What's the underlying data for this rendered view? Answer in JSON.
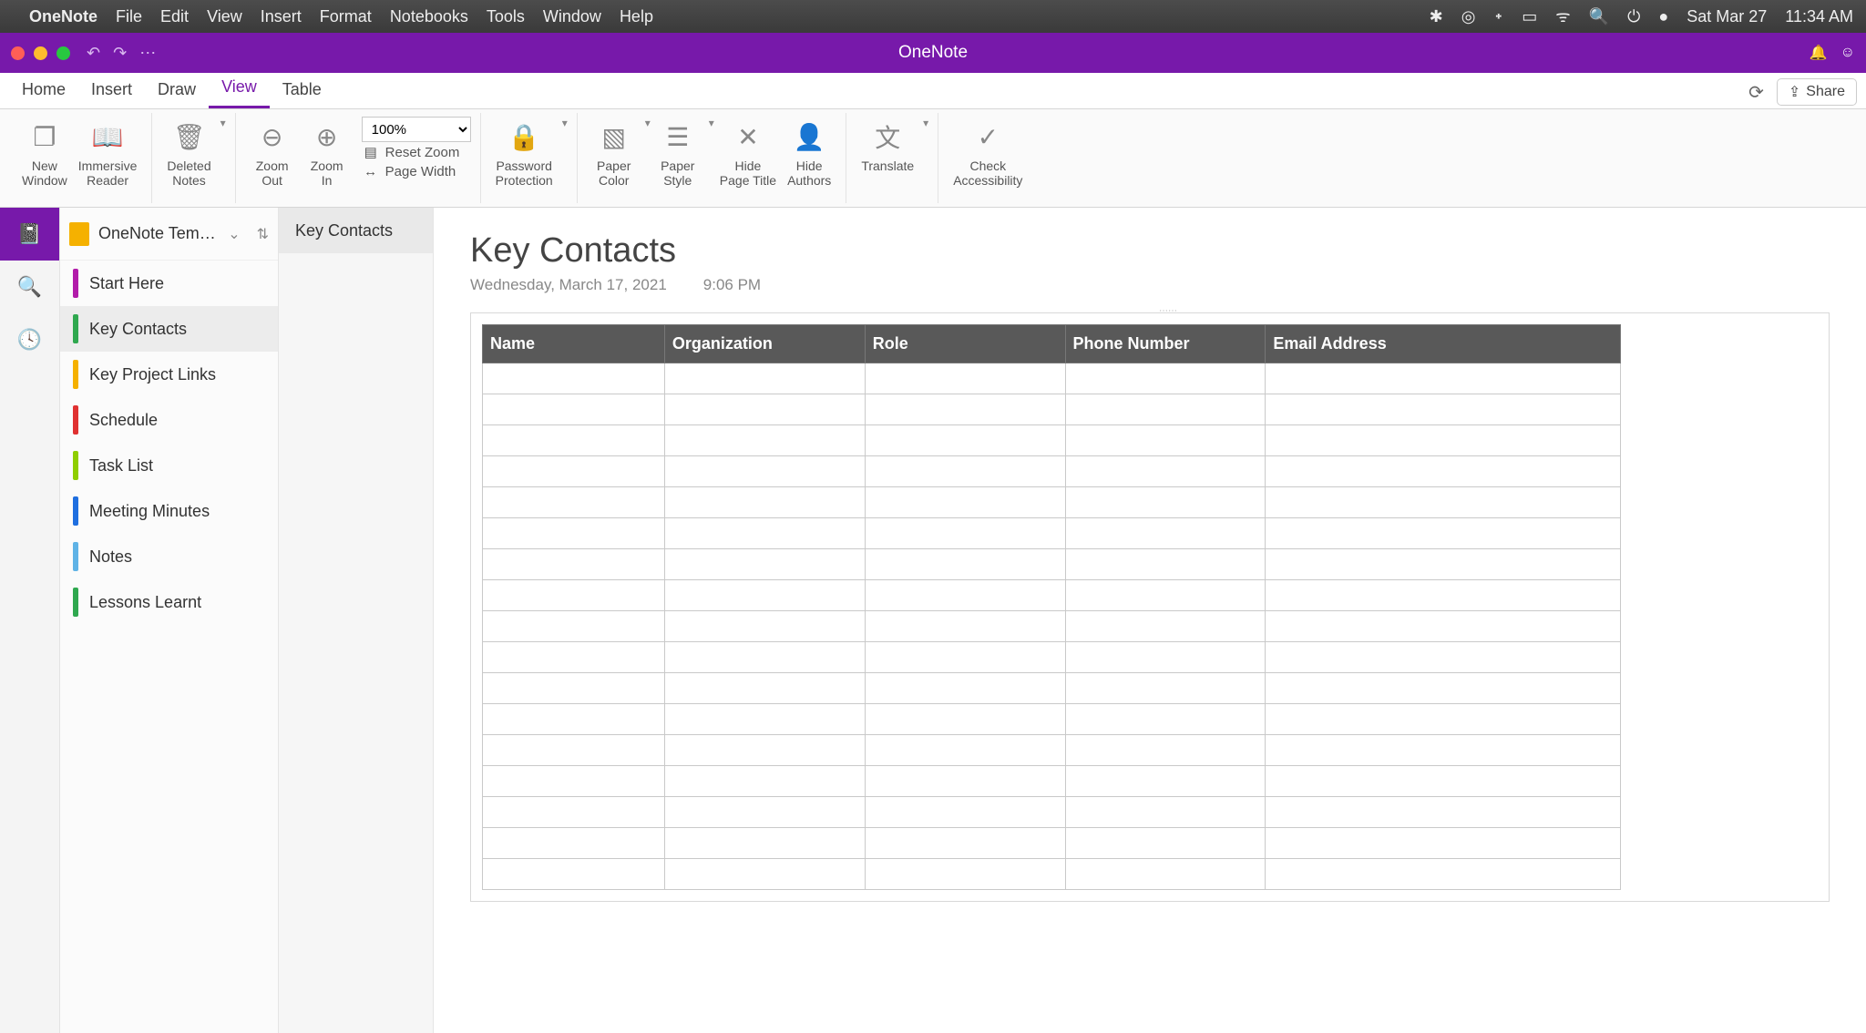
{
  "menubar": {
    "app": "OneNote",
    "items": [
      "File",
      "Edit",
      "View",
      "Insert",
      "Format",
      "Notebooks",
      "Tools",
      "Window",
      "Help"
    ],
    "clock_day": "Sat Mar 27",
    "clock_time": "11:34 AM"
  },
  "titlebar": {
    "title": "OneNote"
  },
  "tabs": {
    "items": [
      "Home",
      "Insert",
      "Draw",
      "View",
      "Table"
    ],
    "active": "View",
    "share": "Share"
  },
  "ribbon": {
    "new_window": "New\nWindow",
    "immersive_reader": "Immersive\nReader",
    "deleted_notes": "Deleted\nNotes",
    "zoom_out": "Zoom\nOut",
    "zoom_in": "Zoom\nIn",
    "zoom_value": "100%",
    "reset_zoom": "Reset Zoom",
    "page_width": "Page Width",
    "password_protection": "Password\nProtection",
    "paper_color": "Paper\nColor",
    "paper_style": "Paper\nStyle",
    "hide_page_title": "Hide\nPage Title",
    "hide_authors": "Hide\nAuthors",
    "translate": "Translate",
    "check_accessibility": "Check\nAccessibility"
  },
  "notebook": {
    "title": "OneNote Template for Pr…"
  },
  "sections": [
    {
      "label": "Start Here",
      "color": "#b21caa"
    },
    {
      "label": "Key Contacts",
      "color": "#2fa84f"
    },
    {
      "label": "Key Project Links",
      "color": "#f5b100"
    },
    {
      "label": "Schedule",
      "color": "#e03131"
    },
    {
      "label": "Task List",
      "color": "#8fce00"
    },
    {
      "label": "Meeting Minutes",
      "color": "#1f6fe0"
    },
    {
      "label": "Notes",
      "color": "#5fb3e6"
    },
    {
      "label": "Lessons Learnt",
      "color": "#2fa84f"
    }
  ],
  "active_section_index": 1,
  "pages": [
    {
      "label": "Key Contacts"
    }
  ],
  "active_page_index": 0,
  "page": {
    "title": "Key Contacts",
    "date": "Wednesday, March 17, 2021",
    "time": "9:06 PM",
    "table_headers": [
      "Name",
      "Organization",
      "Role",
      "Phone Number",
      "Email Address"
    ],
    "table_rows": 17
  }
}
